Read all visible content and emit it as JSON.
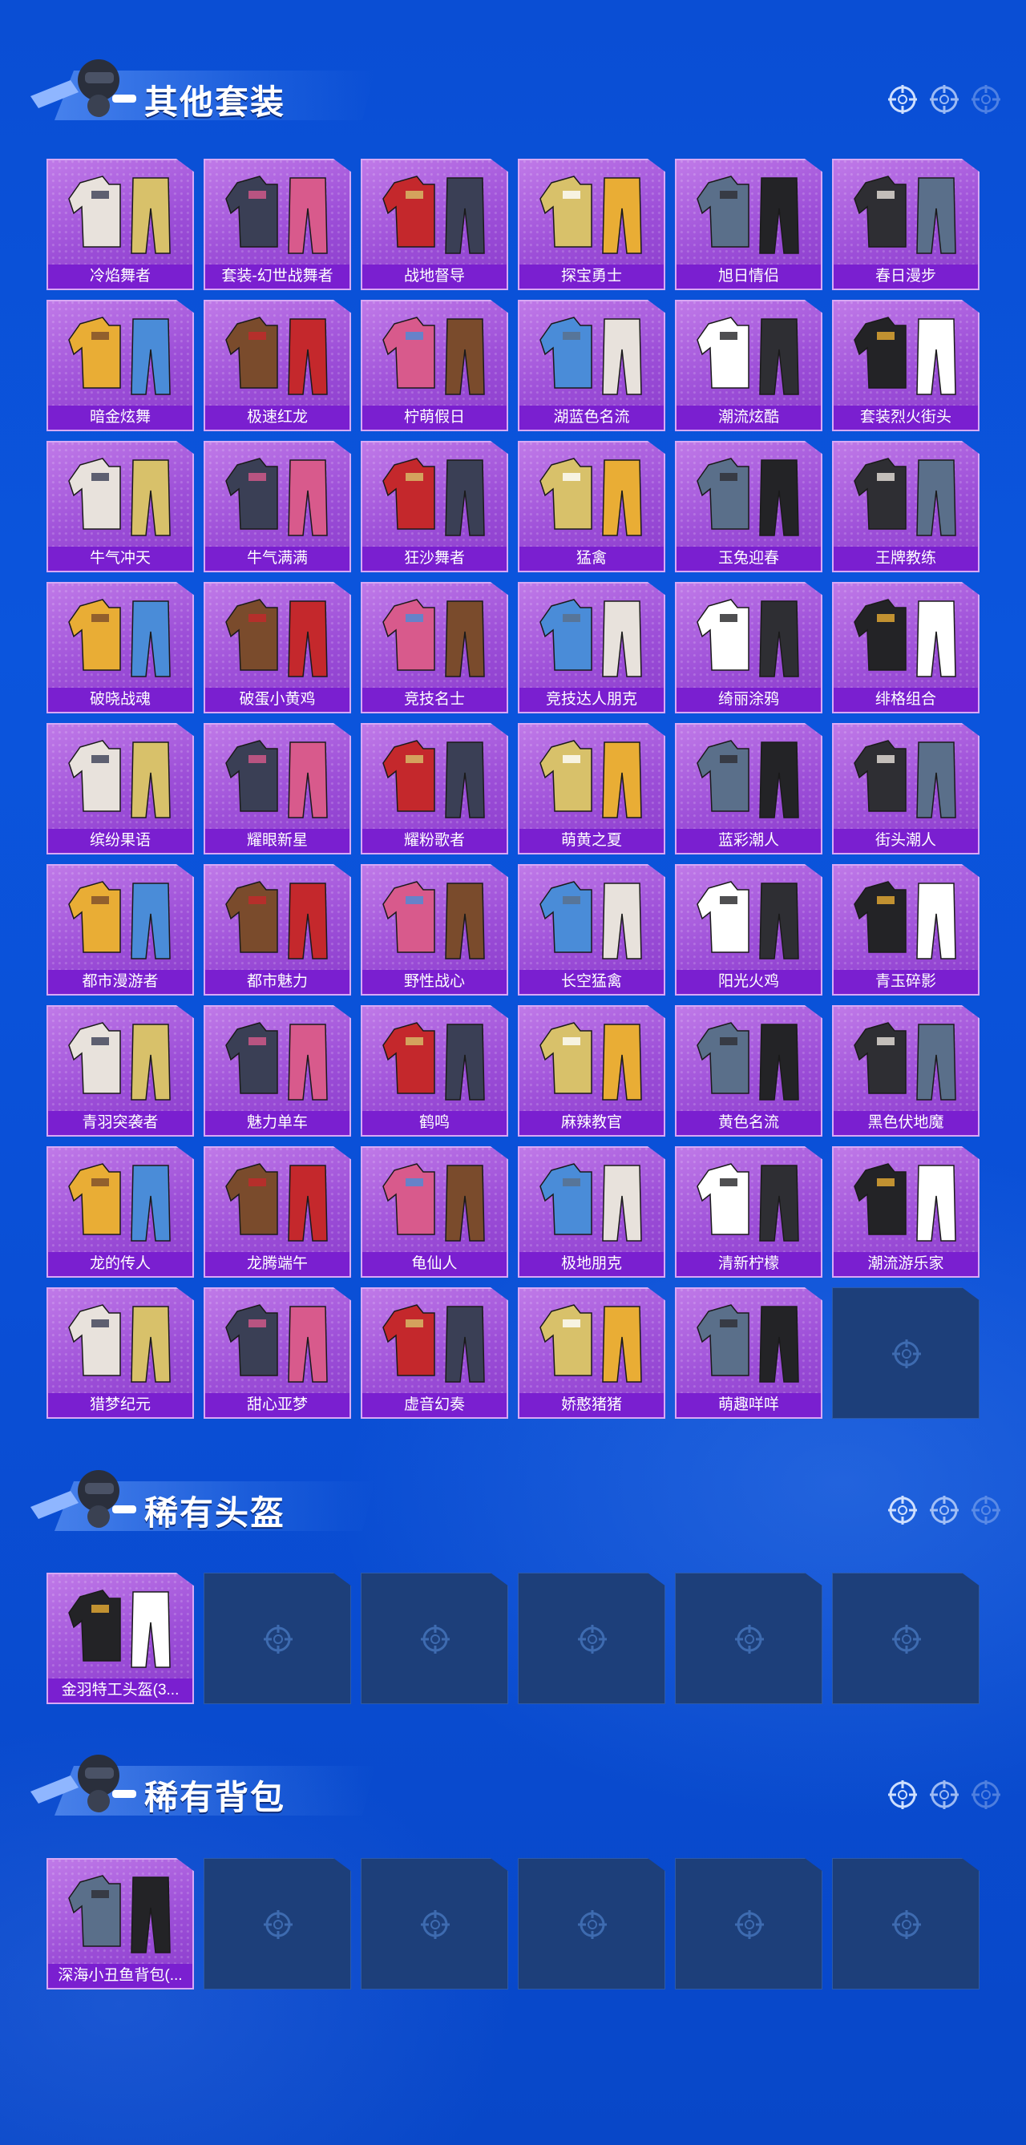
{
  "sections": {
    "outfits": {
      "title": "其他套装",
      "items": [
        "冷焰舞者",
        "套装-幻世战舞者",
        "战地督导",
        "探宝勇士",
        "旭日情侣",
        "春日漫步",
        "暗金炫舞",
        "极速红龙",
        "柠萌假日",
        "湖蓝色名流",
        "潮流炫酷",
        "套装烈火街头",
        "牛气冲天",
        "牛气满满",
        "狂沙舞者",
        "猛禽",
        "玉兔迎春",
        "王牌教练",
        "破晓战魂",
        "破蛋小黄鸡",
        "竞技名士",
        "竞技达人朋克",
        "绮丽涂鸦",
        "绯格组合",
        "缤纷果语",
        "耀眼新星",
        "耀粉歌者",
        "萌黄之夏",
        "蓝彩潮人",
        "街头潮人",
        "都市漫游者",
        "都市魅力",
        "野性战心",
        "长空猛禽",
        "阳光火鸡",
        "青玉碎影",
        "青羽突袭者",
        "魅力单车",
        "鹤鸣",
        "麻辣教官",
        "黄色名流",
        "黑色伏地魔",
        "龙的传人",
        "龙腾端午",
        "龟仙人",
        "极地朋克",
        "清新柠檬",
        "潮流游乐家",
        "猎梦纪元",
        "甜心亚梦",
        "虚音幻奏",
        "娇憨猪猪",
        "萌趣咩咩"
      ],
      "empty_slots": 1
    },
    "helmets": {
      "title": "稀有头盔",
      "items": [
        "金羽特工头盔(3..."
      ],
      "empty_slots": 5
    },
    "backpacks": {
      "title": "稀有背包",
      "items": [
        "深海小丑鱼背包(..."
      ],
      "empty_slots": 5
    }
  },
  "icons": {
    "header_mascot": "soldier-mascot-icon",
    "header_target": "crosshair-icon",
    "empty_slot": "crosshair-icon"
  },
  "colors": {
    "background": "#0b55dd",
    "tile_purple": "#9d4fd8",
    "label_purple": "#7a1fd0",
    "empty_tile": "#1d3f7a"
  }
}
